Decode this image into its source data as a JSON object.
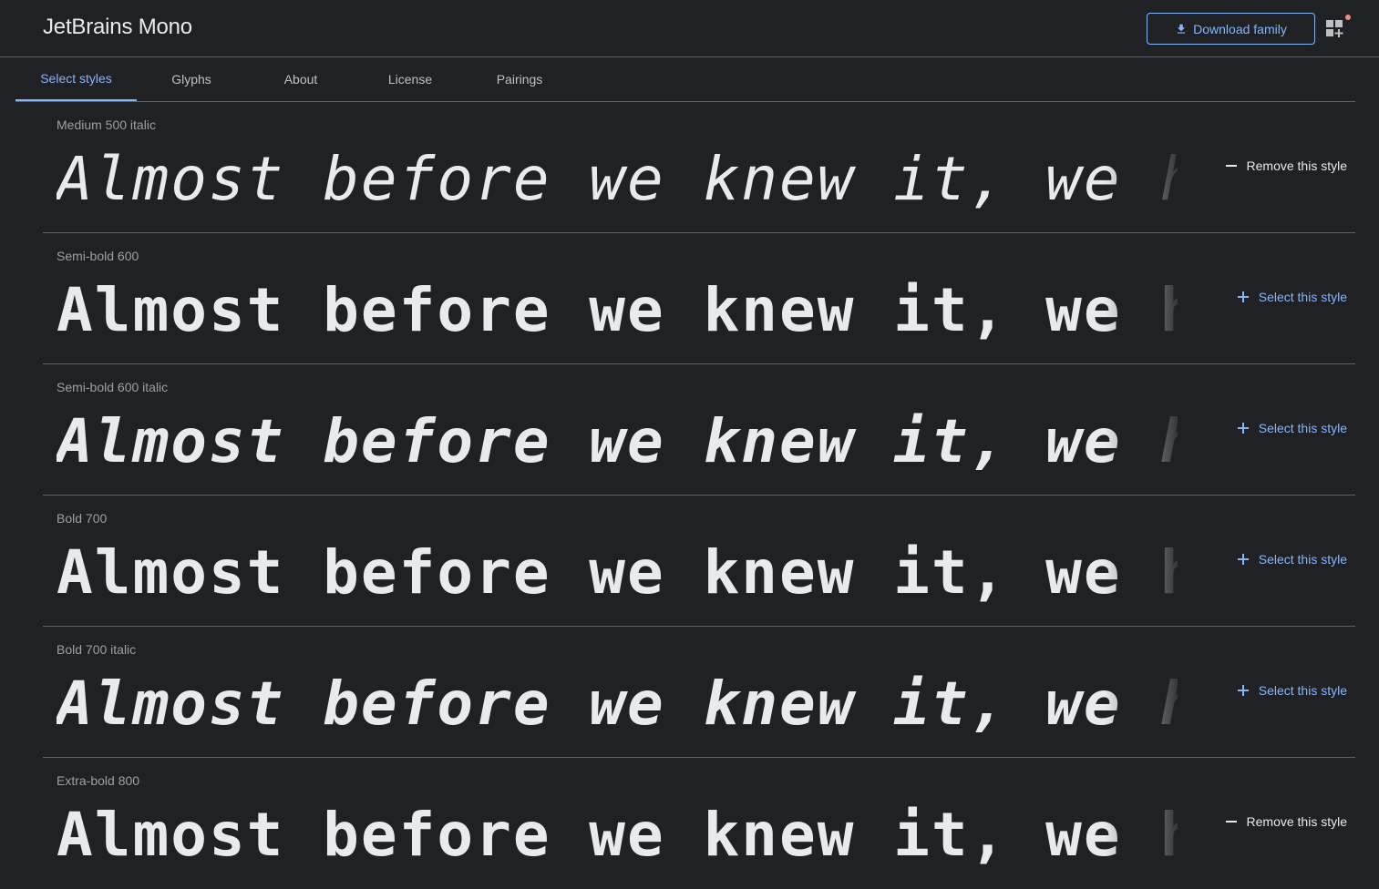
{
  "header": {
    "family_name": "JetBrains Mono",
    "download_label": "Download family",
    "download_icon": "download-icon",
    "apps_icon": "selected-families-icon"
  },
  "tabs": [
    {
      "label": "Select styles",
      "active": true
    },
    {
      "label": "Glyphs",
      "active": false
    },
    {
      "label": "About",
      "active": false
    },
    {
      "label": "License",
      "active": false
    },
    {
      "label": "Pairings",
      "active": false
    }
  ],
  "specimen_text": "Almost before we knew it, we had left the ground.",
  "styles": [
    {
      "label": "Medium 500 italic",
      "action": "Remove this style",
      "selected": true
    },
    {
      "label": "Semi-bold 600",
      "action": "Select this style",
      "selected": false
    },
    {
      "label": "Semi-bold 600 italic",
      "action": "Select this style",
      "selected": false
    },
    {
      "label": "Bold 700",
      "action": "Select this style",
      "selected": false
    },
    {
      "label": "Bold 700 italic",
      "action": "Select this style",
      "selected": false
    },
    {
      "label": "Extra-bold 800",
      "action": "Remove this style",
      "selected": true
    }
  ],
  "colors": {
    "background": "#202124",
    "accent": "#8ab4f8",
    "text": "#e8eaed",
    "muted": "#9aa0a6",
    "divider": "#5f6368"
  }
}
